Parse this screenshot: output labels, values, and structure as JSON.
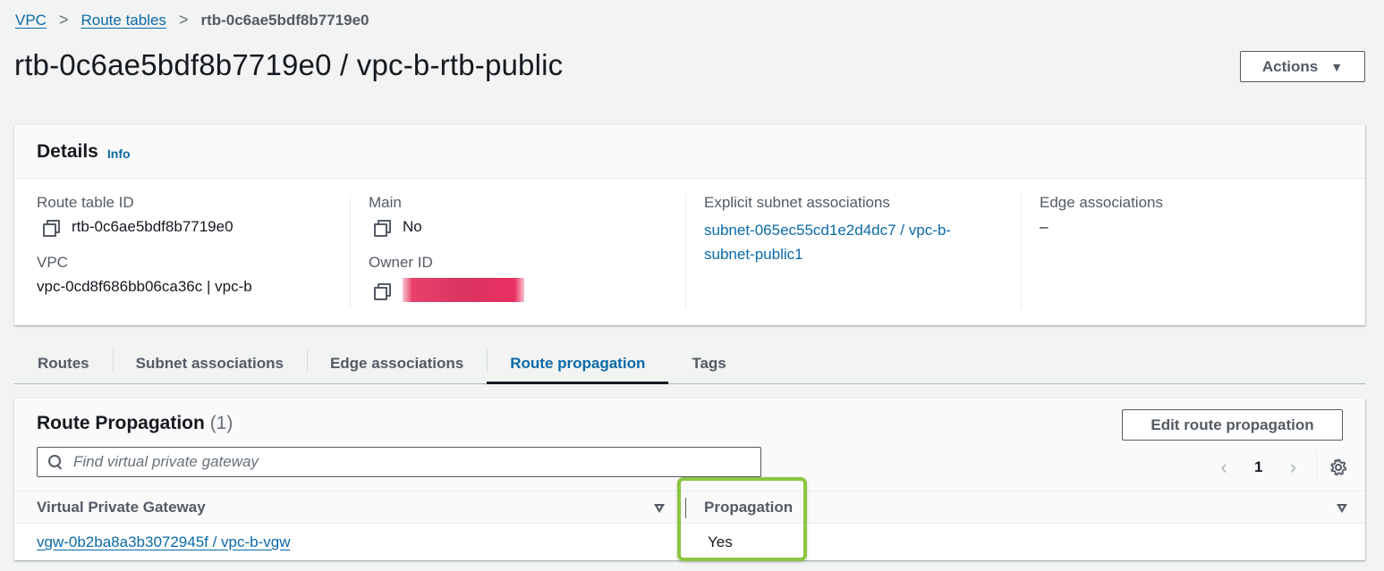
{
  "breadcrumb": {
    "items": [
      {
        "label": "VPC",
        "link": true
      },
      {
        "label": "Route tables",
        "link": true
      },
      {
        "label": "rtb-0c6ae5bdf8b7719e0",
        "link": false
      }
    ],
    "separator": ">"
  },
  "page": {
    "title": "rtb-0c6ae5bdf8b7719e0 / vpc-b-rtb-public",
    "actions_label": "Actions",
    "actions_caret": "▼"
  },
  "details": {
    "title": "Details",
    "info_label": "Info",
    "route_table_id": {
      "label": "Route table ID",
      "value": "rtb-0c6ae5bdf8b7719e0"
    },
    "vpc": {
      "label": "VPC",
      "value": "vpc-0cd8f686bb06ca36c | vpc-b"
    },
    "main": {
      "label": "Main",
      "value": "No"
    },
    "owner_id": {
      "label": "Owner ID",
      "value": "[redacted]"
    },
    "explicit_subnet_associations": {
      "label": "Explicit subnet associations",
      "value": "subnet-065ec55cd1e2d4dc7 / vpc-b-subnet-public1"
    },
    "edge_associations": {
      "label": "Edge associations",
      "value": "–"
    }
  },
  "tabs": [
    {
      "label": "Routes",
      "active": false
    },
    {
      "label": "Subnet associations",
      "active": false
    },
    {
      "label": "Edge associations",
      "active": false
    },
    {
      "label": "Route propagation",
      "active": true
    },
    {
      "label": "Tags",
      "active": false
    }
  ],
  "route_propagation": {
    "title": "Route Propagation",
    "count": "(1)",
    "edit_button_label": "Edit route propagation",
    "search_placeholder": "Find virtual private gateway",
    "search_value": "",
    "pagination": {
      "prev": "‹",
      "current_page": "1",
      "next": "›"
    },
    "columns": [
      "Virtual Private Gateway",
      "Propagation"
    ],
    "rows": [
      {
        "gateway": "vgw-0b2ba8a3b3072945f / vpc-b-vgw",
        "propagation": "Yes"
      }
    ],
    "highlight_color": "#8cc63f"
  },
  "colors": {
    "link": "#0a6aa8",
    "active_tab": "#0a6aa8",
    "background": "#f2f3f3",
    "redaction": "#d93462"
  }
}
